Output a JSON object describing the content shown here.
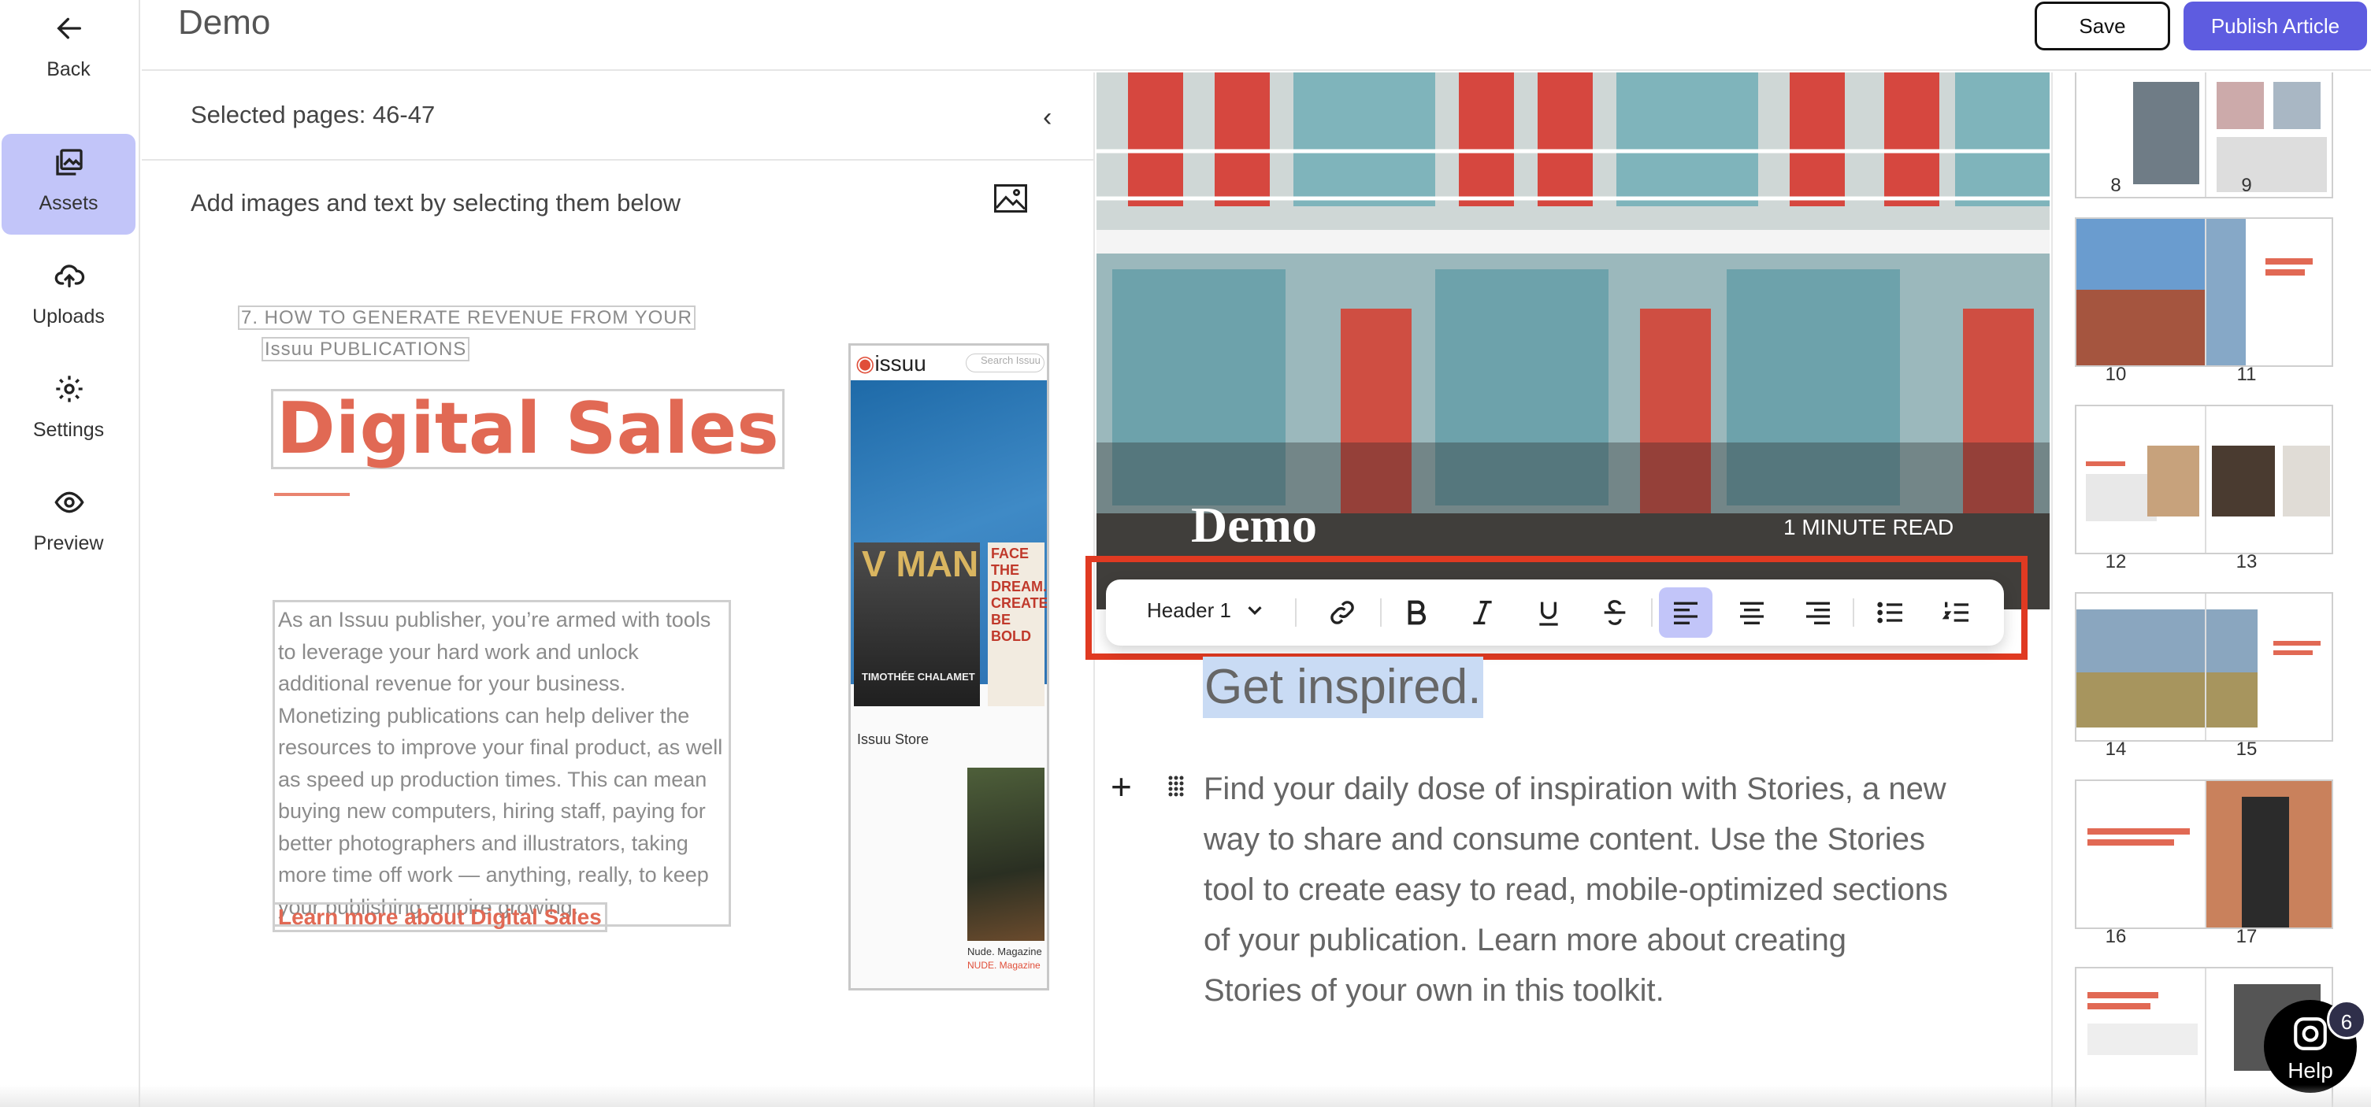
{
  "app": {
    "title": "Demo"
  },
  "nav": {
    "back": "Back",
    "assets": "Assets",
    "uploads": "Uploads",
    "settings": "Settings",
    "preview": "Preview"
  },
  "header": {
    "save": "Save",
    "publish": "Publish Article"
  },
  "assets": {
    "selected": "Selected pages: 46-47",
    "hint": "Add images and text by selecting them below",
    "page": {
      "heading_line1": "7. HOW TO GENERATE REVENUE FROM YOUR",
      "heading_line2": "Issuu PUBLICATIONS",
      "title": "Digital Sales",
      "body": "As an Issuu publisher, you’re armed with tools to leverage your hard work and unlock additional revenue for your business. Monetizing publications can help deliver the resources to improve your final product, as well as speed up production times. This can mean buying new computers, hiring staff, paying for better photographers and illustrators, taking more time off work — anything, really, to keep your publishing empire growing.",
      "link": "Learn more about Digital Sales"
    },
    "phone": {
      "logo": "issuu",
      "search": "Search Issuu",
      "mag1": "V MAN",
      "mag1_name": "TIMOTHÉE CHALAMET",
      "mag2": "FACE THE DREAM. CREATE. BE BOLD",
      "store": "Issuu Store",
      "mag3_label": "Nude. Magazine",
      "mag3_sub": "NUDE. Magazine"
    }
  },
  "editor": {
    "hero_title": "Demo",
    "read_time": "1 MINUTE READ",
    "toolbar": {
      "block_type": "Header 1"
    },
    "heading": "Get inspired.",
    "paragraph": "Find your daily dose of inspiration with Stories, a new way to share and consume content. Use the Stories tool to create easy to read, mobile-optimized sections of your publication. Learn more about creating Stories of your own in this toolkit."
  },
  "thumbnails": {
    "pages": [
      "8",
      "9",
      "10",
      "11",
      "12",
      "13",
      "14",
      "15",
      "16",
      "17"
    ]
  },
  "help": {
    "label": "Help",
    "badge": "6"
  },
  "colors": {
    "accent": "#5e5ce0",
    "active_bg": "#c2c5f9",
    "brand_red": "#e16954",
    "highlight_red": "#e03a22"
  }
}
